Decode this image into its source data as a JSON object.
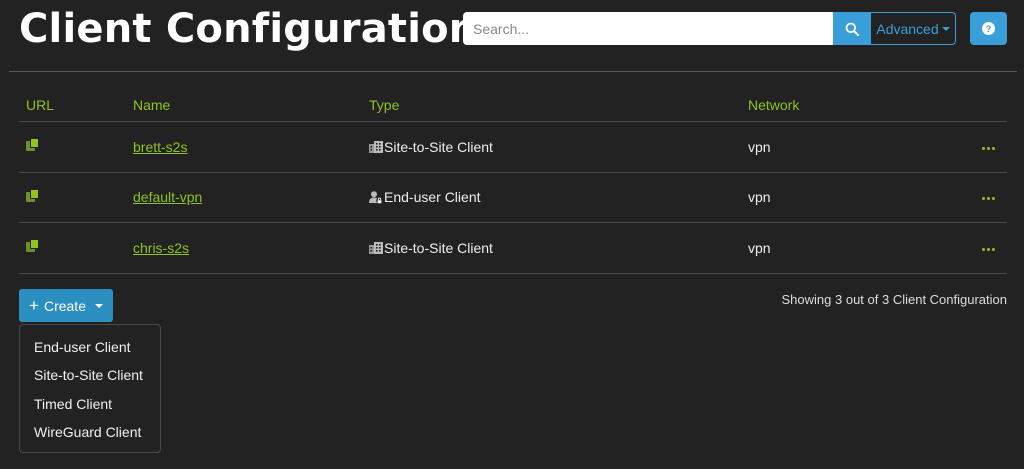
{
  "header": {
    "title": "Client Configuration",
    "search_placeholder": "Search...",
    "advanced_label": "Advanced",
    "help_glyph": "?"
  },
  "table": {
    "columns": [
      "URL",
      "Name",
      "Type",
      "Network"
    ],
    "rows": [
      {
        "name": "brett-s2s",
        "type": "Site-to-Site Client",
        "type_icon": "building-icon",
        "network": "vpn"
      },
      {
        "name": "default-vpn",
        "type": "End-user Client",
        "type_icon": "user-lock-icon",
        "network": "vpn"
      },
      {
        "name": "chris-s2s",
        "type": "Site-to-Site Client",
        "type_icon": "building-icon",
        "network": "vpn"
      }
    ]
  },
  "footer": {
    "create_label": "Create",
    "status": "Showing 3 out of 3 Client Configuration"
  },
  "create_menu": {
    "items": [
      "End-user Client",
      "Site-to-Site Client",
      "Timed Client",
      "WireGuard Client"
    ]
  },
  "colors": {
    "accent_green": "#8fc31f",
    "accent_blue": "#3a9fd8",
    "background": "#222222"
  }
}
